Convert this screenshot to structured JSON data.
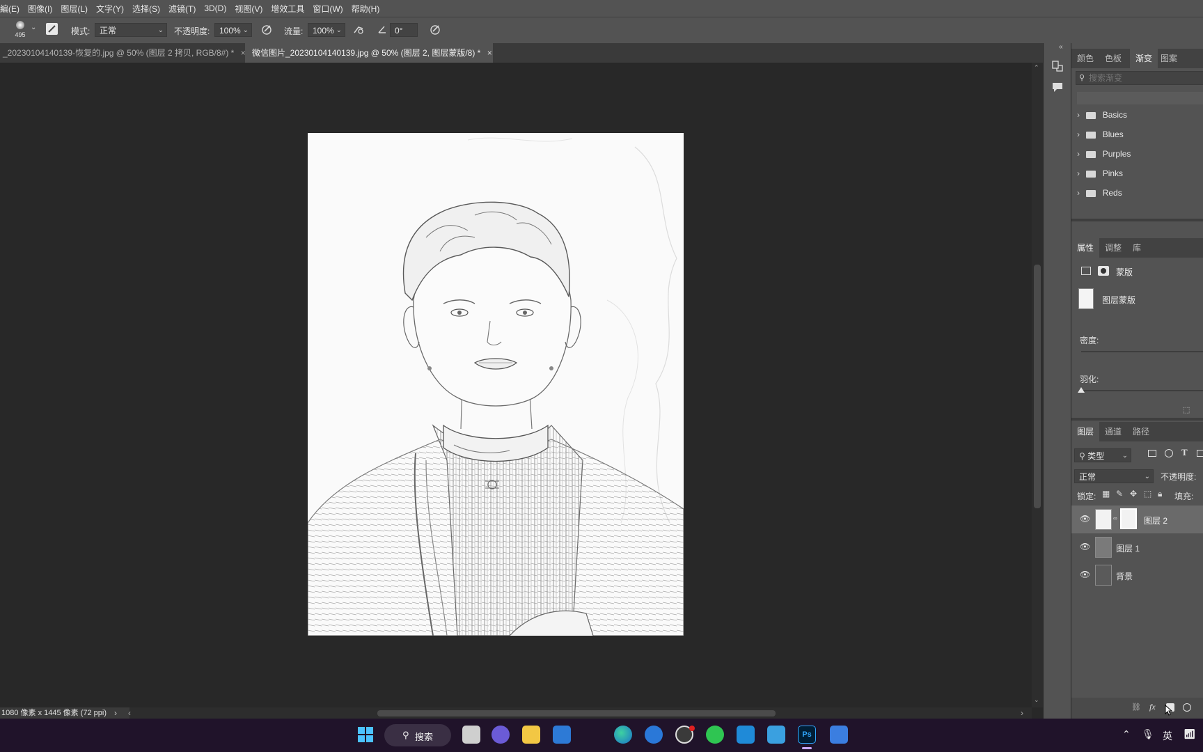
{
  "menu": [
    "編(E)",
    "图像(I)",
    "图层(L)",
    "文字(Y)",
    "选择(S)",
    "滤镜(T)",
    "3D(D)",
    "视图(V)",
    "增效工具",
    "窗口(W)",
    "帮助(H)"
  ],
  "options": {
    "brush_size": "495",
    "mode_label": "模式:",
    "mode_value": "正常",
    "opacity_label": "不透明度:",
    "opacity_value": "100%",
    "flow_label": "流量:",
    "flow_value": "100%",
    "angle_value": "0°"
  },
  "tabs": [
    {
      "label": "_20230104140139-恢复的.jpg @ 50% (图层 2 拷贝, RGB/8#) *",
      "active": false
    },
    {
      "label": "微信图片_20230104140139.jpg @ 50% (图层 2, 图层蒙版/8) *",
      "active": true
    }
  ],
  "status": "1080 像素 x 1445 像素 (72 ppi)",
  "gradient_panel": {
    "tabs": [
      "颜色",
      "色板",
      "渐变",
      "图案"
    ],
    "active_tab": "渐变",
    "search_placeholder": "搜索渐变",
    "folders": [
      "Basics",
      "Blues",
      "Purples",
      "Pinks",
      "Reds"
    ]
  },
  "properties_panel": {
    "tabs": [
      "属性",
      "调整",
      "库"
    ],
    "active_tab": "属性",
    "mask_label": "蒙版",
    "layer_mask_label": "图层蒙版",
    "density_label": "密度:",
    "feather_label": "羽化:"
  },
  "layers_panel": {
    "tabs": [
      "图层",
      "通道",
      "路径"
    ],
    "active_tab": "图层",
    "filter_label": "类型",
    "blend_mode": "正常",
    "opacity_label": "不透明度:",
    "lock_label": "锁定:",
    "fill_label": "填充:",
    "layers": [
      {
        "name": "图层 2",
        "selected": true,
        "has_mask": true
      },
      {
        "name": "图层 1",
        "selected": false,
        "has_mask": false
      },
      {
        "name": "背景",
        "selected": false,
        "has_mask": false
      }
    ]
  },
  "taskbar": {
    "search_label": "搜索",
    "ime_label": "英"
  }
}
